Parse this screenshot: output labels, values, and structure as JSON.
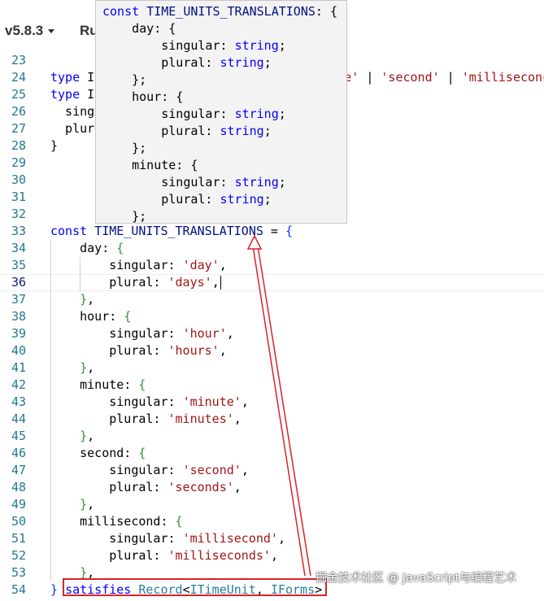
{
  "toolbar": {
    "version_label": "v5.8.3",
    "run_label": "Ru"
  },
  "hover": {
    "lines": [
      [
        [
          "hkw",
          "const"
        ],
        [
          "pun",
          " "
        ],
        [
          "hid",
          "TIME_UNITS_TRANSLATIONS"
        ],
        [
          "pun",
          ": {"
        ]
      ],
      [
        [
          "pun",
          "    day: {"
        ]
      ],
      [
        [
          "pun",
          "        singular: "
        ],
        [
          "hty",
          "string"
        ],
        [
          "pun",
          ";"
        ]
      ],
      [
        [
          "pun",
          "        plural: "
        ],
        [
          "hty",
          "string"
        ],
        [
          "pun",
          ";"
        ]
      ],
      [
        [
          "pun",
          "    };"
        ]
      ],
      [
        [
          "pun",
          "    hour: {"
        ]
      ],
      [
        [
          "pun",
          "        singular: "
        ],
        [
          "hty",
          "string"
        ],
        [
          "pun",
          ";"
        ]
      ],
      [
        [
          "pun",
          "        plural: "
        ],
        [
          "hty",
          "string"
        ],
        [
          "pun",
          ";"
        ]
      ],
      [
        [
          "pun",
          "    };"
        ]
      ],
      [
        [
          "pun",
          "    minute: {"
        ]
      ],
      [
        [
          "pun",
          "        singular: "
        ],
        [
          "hty",
          "string"
        ],
        [
          "pun",
          ";"
        ]
      ],
      [
        [
          "pun",
          "        plural: "
        ],
        [
          "hty",
          "string"
        ],
        [
          "pun",
          ";"
        ]
      ],
      [
        [
          "pun",
          "    };"
        ]
      ]
    ]
  },
  "editor": {
    "active_line": 36,
    "lines": [
      {
        "n": "23",
        "t": []
      },
      {
        "n": "24",
        "t": [
          [
            "kw",
            "type"
          ],
          [
            "pun",
            " I"
          ],
          [
            "pun",
            "                                  "
          ],
          [
            "str",
            "e'"
          ],
          [
            "pun",
            " | "
          ],
          [
            "str",
            "'second'"
          ],
          [
            "pun",
            " | "
          ],
          [
            "str",
            "'milliseconc"
          ]
        ]
      },
      {
        "n": "25",
        "t": [
          [
            "kw",
            "type"
          ],
          [
            "pun",
            " I"
          ]
        ]
      },
      {
        "n": "26",
        "t": [
          [
            "pun",
            "  singu"
          ]
        ]
      },
      {
        "n": "27",
        "t": [
          [
            "pun",
            "  plur"
          ]
        ]
      },
      {
        "n": "28",
        "t": [
          [
            "pun",
            "}"
          ]
        ]
      },
      {
        "n": "29",
        "t": []
      },
      {
        "n": "30",
        "t": []
      },
      {
        "n": "31",
        "t": []
      },
      {
        "n": "32",
        "t": []
      },
      {
        "n": "33",
        "t": [
          [
            "kw",
            "const"
          ],
          [
            "pun",
            " "
          ],
          [
            "id",
            "TIME_UNITS_TRANSLATIONS"
          ],
          [
            "pun",
            " = "
          ],
          [
            "br2",
            "{"
          ]
        ]
      },
      {
        "n": "34",
        "t": [
          [
            "pun",
            "    day: "
          ],
          [
            "br1",
            "{"
          ]
        ]
      },
      {
        "n": "35",
        "t": [
          [
            "pun",
            "        singular: "
          ],
          [
            "str",
            "'day'"
          ],
          [
            "pun",
            ","
          ]
        ]
      },
      {
        "n": "36",
        "t": [
          [
            "pun",
            "        plural: "
          ],
          [
            "str",
            "'days'"
          ],
          [
            "pun",
            ","
          ]
        ],
        "cursor": true
      },
      {
        "n": "37",
        "t": [
          [
            "pun",
            "    "
          ],
          [
            "br1",
            "}"
          ],
          [
            "pun",
            ","
          ]
        ]
      },
      {
        "n": "38",
        "t": [
          [
            "pun",
            "    hour: "
          ],
          [
            "br1",
            "{"
          ]
        ]
      },
      {
        "n": "39",
        "t": [
          [
            "pun",
            "        singular: "
          ],
          [
            "str",
            "'hour'"
          ],
          [
            "pun",
            ","
          ]
        ]
      },
      {
        "n": "40",
        "t": [
          [
            "pun",
            "        plural: "
          ],
          [
            "str",
            "'hours'"
          ],
          [
            "pun",
            ","
          ]
        ]
      },
      {
        "n": "41",
        "t": [
          [
            "pun",
            "    "
          ],
          [
            "br1",
            "}"
          ],
          [
            "pun",
            ","
          ]
        ]
      },
      {
        "n": "42",
        "t": [
          [
            "pun",
            "    minute: "
          ],
          [
            "br1",
            "{"
          ]
        ]
      },
      {
        "n": "43",
        "t": [
          [
            "pun",
            "        singular: "
          ],
          [
            "str",
            "'minute'"
          ],
          [
            "pun",
            ","
          ]
        ]
      },
      {
        "n": "44",
        "t": [
          [
            "pun",
            "        plural: "
          ],
          [
            "str",
            "'minutes'"
          ],
          [
            "pun",
            ","
          ]
        ]
      },
      {
        "n": "45",
        "t": [
          [
            "pun",
            "    "
          ],
          [
            "br1",
            "}"
          ],
          [
            "pun",
            ","
          ]
        ]
      },
      {
        "n": "46",
        "t": [
          [
            "pun",
            "    second: "
          ],
          [
            "br1",
            "{"
          ]
        ]
      },
      {
        "n": "47",
        "t": [
          [
            "pun",
            "        singular: "
          ],
          [
            "str",
            "'second'"
          ],
          [
            "pun",
            ","
          ]
        ]
      },
      {
        "n": "48",
        "t": [
          [
            "pun",
            "        plural: "
          ],
          [
            "str",
            "'seconds'"
          ],
          [
            "pun",
            ","
          ]
        ]
      },
      {
        "n": "49",
        "t": [
          [
            "pun",
            "    "
          ],
          [
            "br1",
            "}"
          ],
          [
            "pun",
            ","
          ]
        ]
      },
      {
        "n": "50",
        "t": [
          [
            "pun",
            "    millisecond: "
          ],
          [
            "br1",
            "{"
          ]
        ]
      },
      {
        "n": "51",
        "t": [
          [
            "pun",
            "        singular: "
          ],
          [
            "str",
            "'millisecond'"
          ],
          [
            "pun",
            ","
          ]
        ]
      },
      {
        "n": "52",
        "t": [
          [
            "pun",
            "        plural: "
          ],
          [
            "str",
            "'milliseconds'"
          ],
          [
            "pun",
            ","
          ]
        ]
      },
      {
        "n": "53",
        "t": [
          [
            "pun",
            "    "
          ],
          [
            "br1",
            "}"
          ],
          [
            "pun",
            ","
          ]
        ]
      },
      {
        "n": "54",
        "t": [
          [
            "br2",
            "}"
          ],
          [
            "pun",
            " "
          ],
          [
            "kw",
            "satisfies"
          ],
          [
            "pun",
            " "
          ],
          [
            "ty",
            "Record"
          ],
          [
            "pun",
            "<"
          ],
          [
            "ty",
            "ITimeUnit"
          ],
          [
            "pun",
            ", "
          ],
          [
            "ty",
            "IForms"
          ],
          [
            "pun",
            ">"
          ]
        ]
      }
    ]
  },
  "watermark": "掘金技术社区 @ JavaScript与编程艺术"
}
